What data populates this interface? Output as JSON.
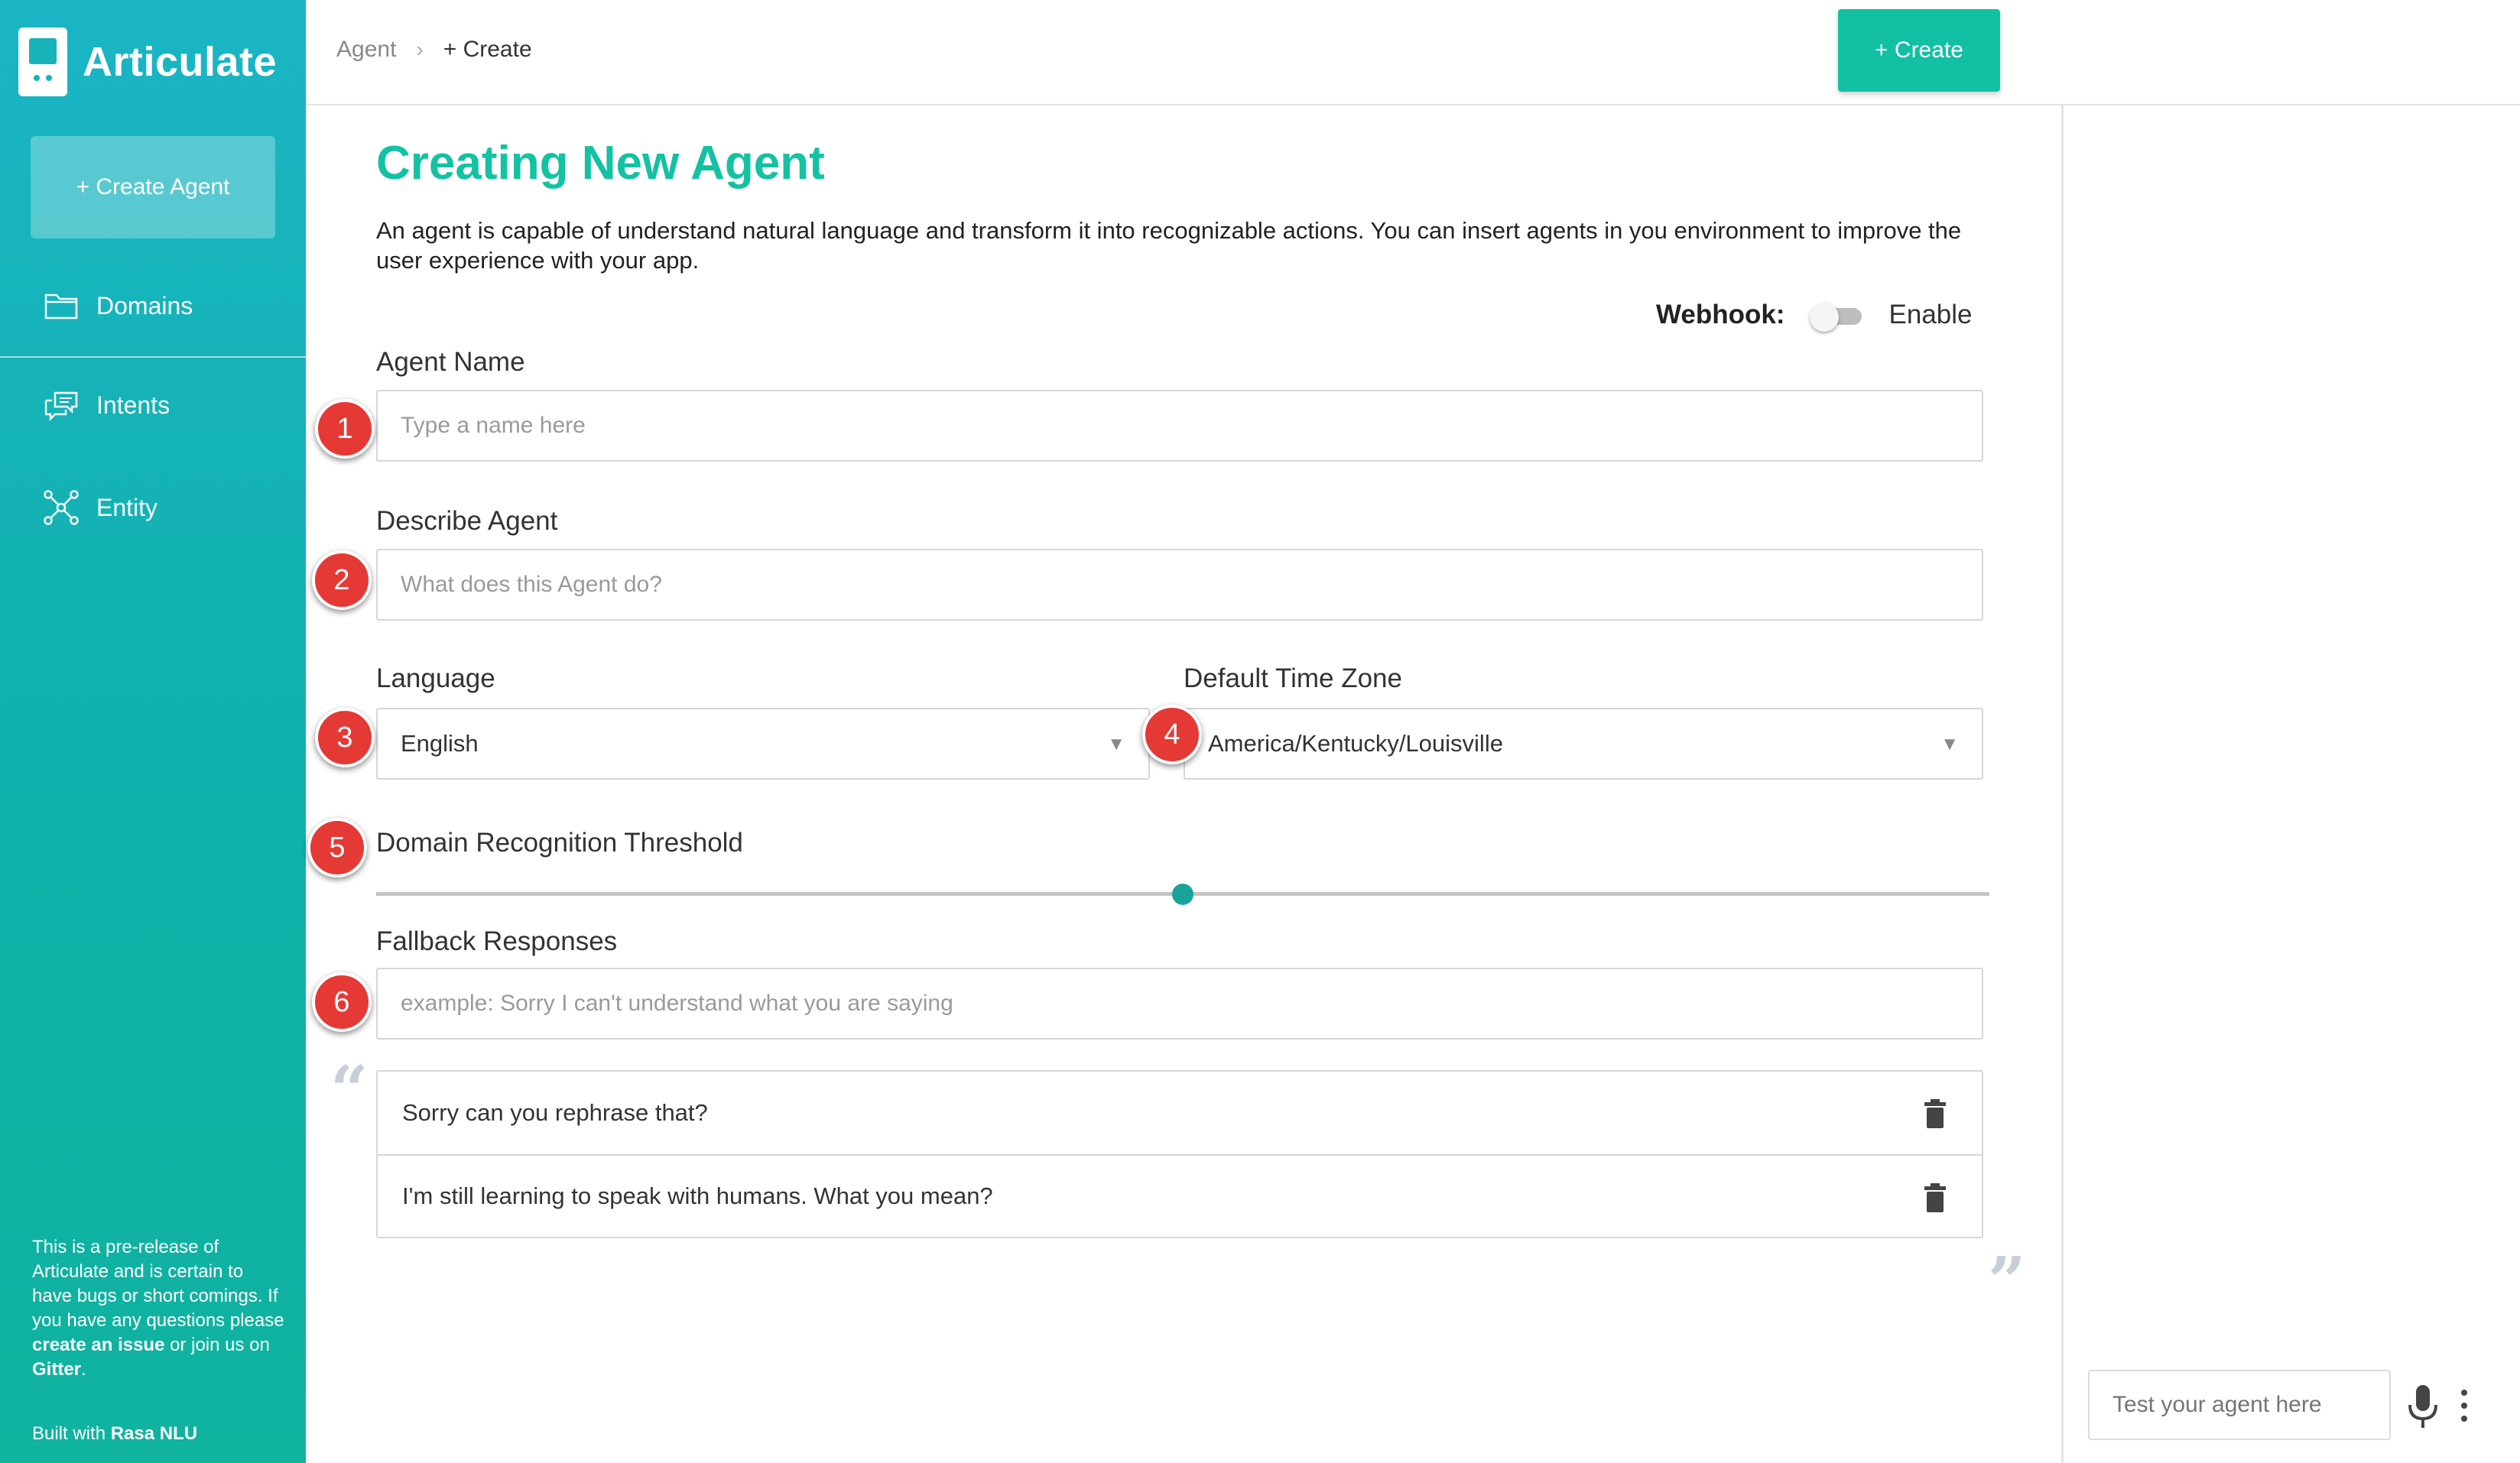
{
  "app": {
    "name": "Articulate"
  },
  "sidebar": {
    "create_agent_label": "+ Create Agent",
    "items": [
      {
        "label": "Domains",
        "icon": "folder-icon"
      },
      {
        "label": "Intents",
        "icon": "chat-icon"
      },
      {
        "label": "Entity",
        "icon": "network-icon"
      }
    ],
    "note": {
      "part1": "This is a pre-release of Articulate and is certain to have bugs or short comings. If you have any questions please ",
      "link1": "create an issue",
      "part2": " or join us on ",
      "link2": "Gitter",
      "part3": "."
    },
    "built_with": {
      "prefix": "Built with ",
      "name": "Rasa NLU"
    }
  },
  "header": {
    "breadcrumb": {
      "parent": "Agent",
      "separator": "›",
      "current": "+ Create"
    },
    "create_button_label": "+ Create"
  },
  "form": {
    "title": "Creating New Agent",
    "description": "An agent is capable of understand natural language and transform it into recognizable actions. You can insert agents in you environment to improve the user experience with your app.",
    "webhook": {
      "label": "Webhook:",
      "enable_label": "Enable",
      "enabled": false
    },
    "agent_name": {
      "label": "Agent Name",
      "placeholder": "Type a name here",
      "value": ""
    },
    "describe_agent": {
      "label": "Describe Agent",
      "placeholder": "What does this Agent do?",
      "value": ""
    },
    "language": {
      "label": "Language",
      "value": "English"
    },
    "timezone": {
      "label": "Default Time Zone",
      "value": "America/Kentucky/Louisville"
    },
    "threshold": {
      "label": "Domain Recognition Threshold",
      "value": 0.5
    },
    "fallback": {
      "label": "Fallback Responses",
      "placeholder": "example: Sorry I can't understand what you are saying",
      "responses": [
        "Sorry can you rephrase that?",
        "I'm still learning to speak with humans. What you mean?"
      ]
    }
  },
  "annotations": [
    "1",
    "2",
    "3",
    "4",
    "5",
    "6"
  ],
  "test_panel": {
    "placeholder": "Test your agent here"
  },
  "colors": {
    "accent": "#13c2a3",
    "sidebar": "#12b3b5",
    "badge": "#e53935"
  }
}
